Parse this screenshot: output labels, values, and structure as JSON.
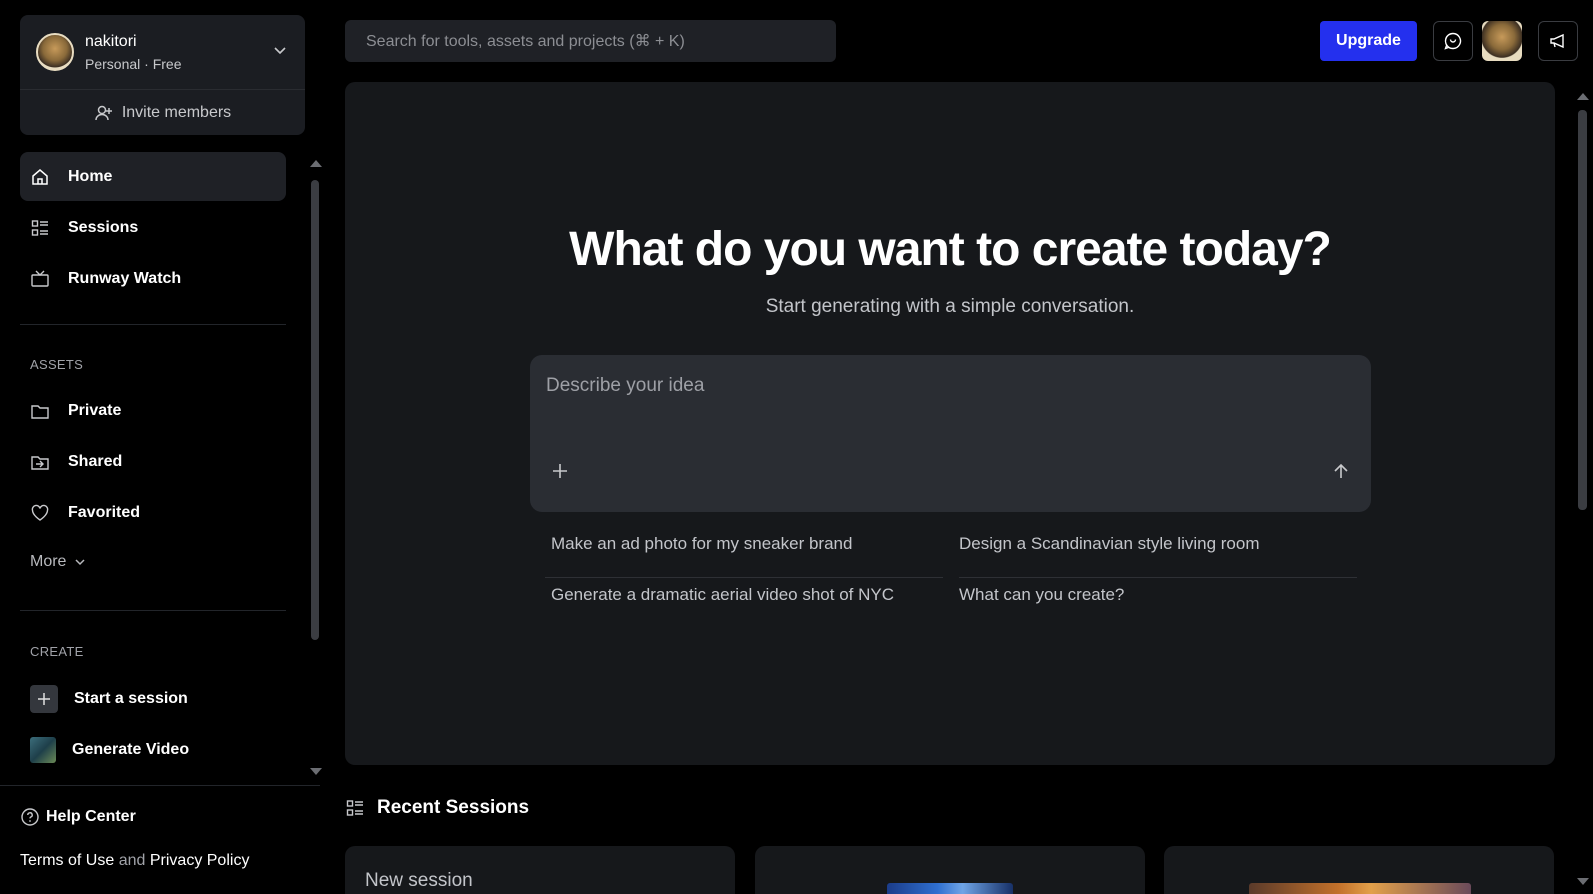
{
  "account": {
    "name": "nakitori",
    "plan": "Personal · Free",
    "invite_label": "Invite members"
  },
  "nav": {
    "home": "Home",
    "sessions": "Sessions",
    "watch": "Runway Watch"
  },
  "assets": {
    "heading": "ASSETS",
    "private": "Private",
    "shared": "Shared",
    "favorited": "Favorited",
    "more": "More"
  },
  "create": {
    "heading": "CREATE",
    "start_session": "Start a session",
    "generate_video": "Generate Video"
  },
  "footer": {
    "help": "Help Center",
    "terms": "Terms of Use",
    "and": "and",
    "privacy": "Privacy Policy"
  },
  "topbar": {
    "search_placeholder": "Search for tools, assets and projects (⌘ + K)",
    "upgrade": "Upgrade"
  },
  "hero": {
    "title": "What do you want to create today?",
    "subtitle": "Start generating with a simple conversation.",
    "prompt_placeholder": "Describe your idea",
    "suggestions": [
      "Make an ad photo for my sneaker brand",
      "Design a Scandinavian style living room",
      "Generate a dramatic aerial video shot of NYC",
      "What can you create?"
    ]
  },
  "recent": {
    "heading": "Recent Sessions",
    "cards": [
      {
        "title": "New session"
      }
    ]
  },
  "colors": {
    "accent": "#2430ee",
    "panel": "#16181b",
    "input": "#2a2d33"
  }
}
